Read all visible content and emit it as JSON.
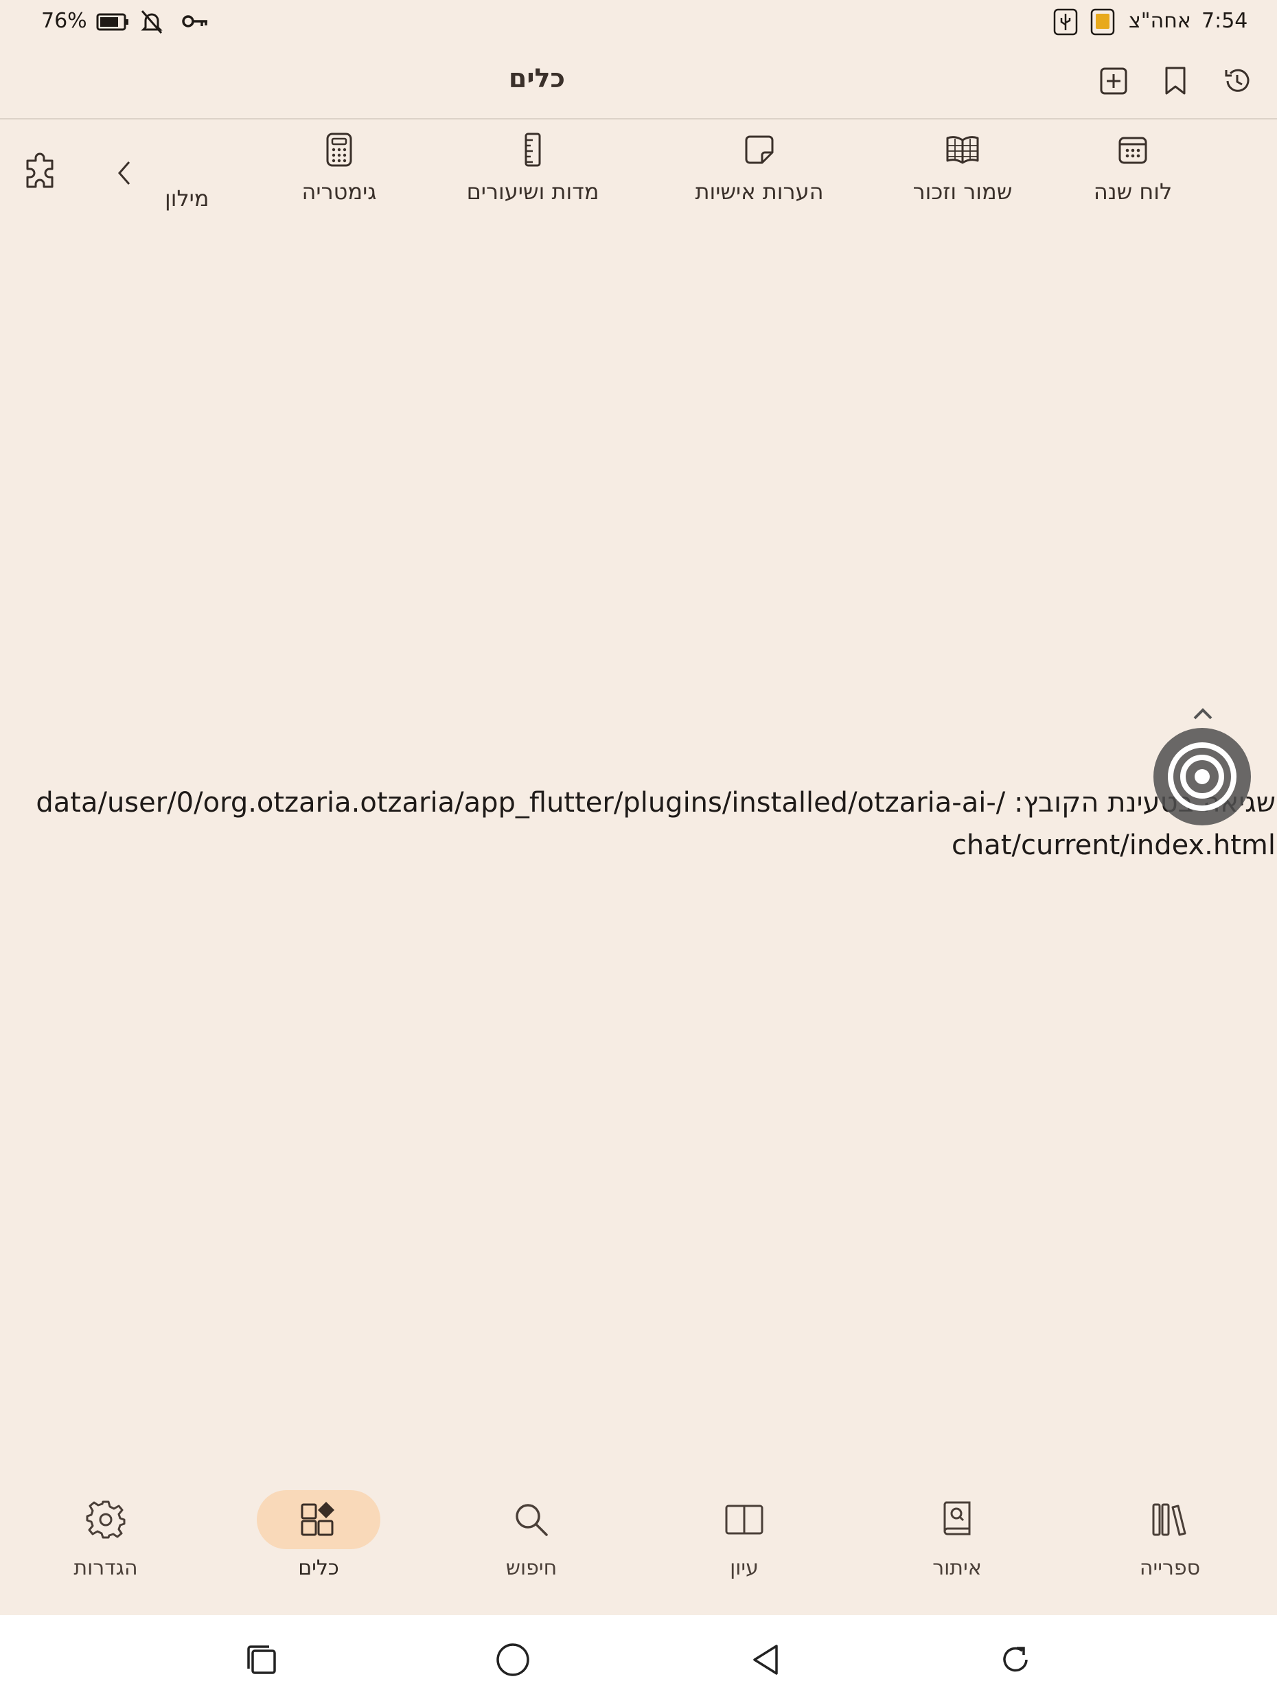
{
  "status_bar": {
    "time": "7:54",
    "date_label": "אחה\"צ",
    "battery": "76%"
  },
  "app_bar": {
    "title": "כלים"
  },
  "tools": [
    {
      "label": "לוח שנה",
      "icon": "calendar-icon"
    },
    {
      "label": "שמור וזכור",
      "icon": "book-open-icon"
    },
    {
      "label": "הערות אישיות",
      "icon": "sticky-note-icon"
    },
    {
      "label": "מדות ושיעורים",
      "icon": "ruler-icon"
    },
    {
      "label": "גימטריה",
      "icon": "calculator-icon"
    },
    {
      "label": "מילון",
      "icon": ""
    }
  ],
  "error": {
    "message": "שגיאה בטעינת הקובץ: /data/user/0/org.otzaria.otzaria/app_flutter/plugins/installed/otzaria-ai-chat/current/index.html"
  },
  "bottom_nav": [
    {
      "label": "ספרייה",
      "icon": "library-icon",
      "active": false
    },
    {
      "label": "איתור",
      "icon": "find-book-icon",
      "active": false
    },
    {
      "label": "עיון",
      "icon": "open-book-icon",
      "active": false
    },
    {
      "label": "חיפוש",
      "icon": "search-icon",
      "active": false
    },
    {
      "label": "כלים",
      "icon": "tools-icon",
      "active": true
    },
    {
      "label": "הגדרות",
      "icon": "gear-icon",
      "active": false
    }
  ],
  "colors": {
    "background": "#F6ECE3",
    "active_pill": "#F9D9B9",
    "text": "#2E2620"
  }
}
